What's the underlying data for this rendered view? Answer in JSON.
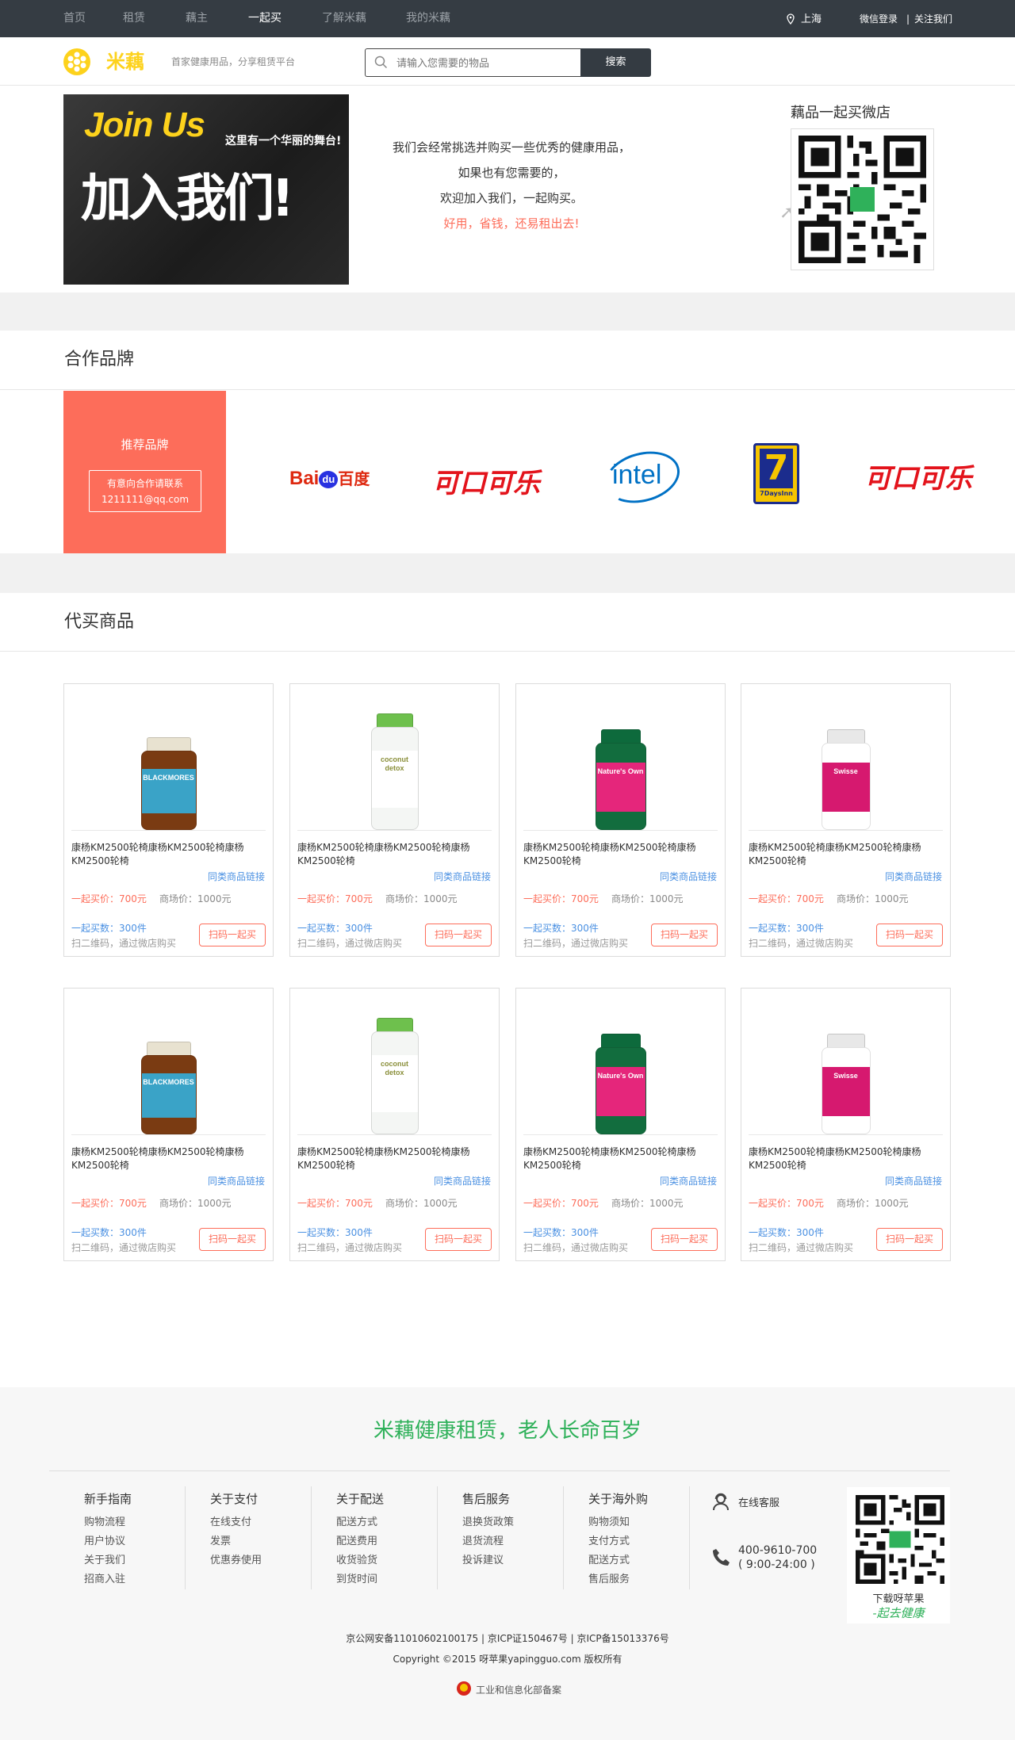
{
  "topnav": {
    "items": [
      "首页",
      "租赁",
      "藕主",
      "一起买",
      "了解米藕",
      "我的米藕"
    ],
    "active_index": 3,
    "location": "上海",
    "login": "微信登录",
    "separator": "|",
    "follow": "关注我们"
  },
  "header": {
    "logo_text": "米藕",
    "slogan": "首家健康用品，分享租赁平台",
    "search_placeholder": "请输入您需要的物品",
    "search_button": "搜索"
  },
  "hero": {
    "banner_join": "Join Us",
    "banner_sub": "这里有一个华丽的舞台!",
    "banner_big": "加入我们!",
    "lines": [
      "我们会经常挑选并购买一些优秀的健康用品，",
      "如果也有您需要的，",
      "欢迎加入我们，一起购买。"
    ],
    "highlight": "好用，省钱，还易租出去!",
    "qr_title": "藕品一起买微店"
  },
  "brands": {
    "title": "合作品牌",
    "recommend": "推荐品牌",
    "contact_label": "有意向合作请联系",
    "contact_email": "1211111@qq.com",
    "logos": [
      "Baidu百度",
      "可口可乐",
      "intel",
      "7 Days Inn",
      "可口可乐"
    ]
  },
  "products": {
    "title": "代买商品",
    "items": [
      {
        "title": "康杨KM2500轮椅康杨KM2500轮椅康杨KM2500轮椅",
        "link": "同类商品链接",
        "price": "一起买价：700元",
        "market": "商场价：1000元",
        "sold": "一起买数：300件",
        "scan": "扫二维码，通过微店购买",
        "button": "扫码一起买",
        "brand": "BLACKMORES"
      },
      {
        "title": "康杨KM2500轮椅康杨KM2500轮椅康杨KM2500轮椅",
        "link": "同类商品链接",
        "price": "一起买价：700元",
        "market": "商场价：1000元",
        "sold": "一起买数：300件",
        "scan": "扫二维码，通过微店购买",
        "button": "扫码一起买",
        "brand": "coconut detox"
      },
      {
        "title": "康杨KM2500轮椅康杨KM2500轮椅康杨KM2500轮椅",
        "link": "同类商品链接",
        "price": "一起买价：700元",
        "market": "商场价：1000元",
        "sold": "一起买数：300件",
        "scan": "扫二维码，通过微店购买",
        "button": "扫码一起买",
        "brand": "Nature's Own"
      },
      {
        "title": "康杨KM2500轮椅康杨KM2500轮椅康杨KM2500轮椅",
        "link": "同类商品链接",
        "price": "一起买价：700元",
        "market": "商场价：1000元",
        "sold": "一起买数：300件",
        "scan": "扫二维码，通过微店购买",
        "button": "扫码一起买",
        "brand": "Swisse"
      },
      {
        "title": "康杨KM2500轮椅康杨KM2500轮椅康杨KM2500轮椅",
        "link": "同类商品链接",
        "price": "一起买价：700元",
        "market": "商场价：1000元",
        "sold": "一起买数：300件",
        "scan": "扫二维码，通过微店购买",
        "button": "扫码一起买",
        "brand": "BLACKMORES"
      },
      {
        "title": "康杨KM2500轮椅康杨KM2500轮椅康杨KM2500轮椅",
        "link": "同类商品链接",
        "price": "一起买价：700元",
        "market": "商场价：1000元",
        "sold": "一起买数：300件",
        "scan": "扫二维码，通过微店购买",
        "button": "扫码一起买",
        "brand": "coconut detox"
      },
      {
        "title": "康杨KM2500轮椅康杨KM2500轮椅康杨KM2500轮椅",
        "link": "同类商品链接",
        "price": "一起买价：700元",
        "market": "商场价：1000元",
        "sold": "一起买数：300件",
        "scan": "扫二维码，通过微店购买",
        "button": "扫码一起买",
        "brand": "Nature's Own"
      },
      {
        "title": "康杨KM2500轮椅康杨KM2500轮椅康杨KM2500轮椅",
        "link": "同类商品链接",
        "price": "一起买价：700元",
        "market": "商场价：1000元",
        "sold": "一起买数：300件",
        "scan": "扫二维码，通过微店购买",
        "button": "扫码一起买",
        "brand": "Swisse"
      }
    ]
  },
  "footer": {
    "slogan": "米藕健康租赁，老人长命百岁",
    "columns": [
      {
        "title": "新手指南",
        "links": [
          "购物流程",
          "用户协议",
          "关于我们",
          "招商入驻"
        ]
      },
      {
        "title": "关于支付",
        "links": [
          "在线支付",
          "发票",
          "优惠券使用"
        ]
      },
      {
        "title": "关于配送",
        "links": [
          "配送方式",
          "配送费用",
          "收货验货",
          "到货时间"
        ]
      },
      {
        "title": "售后服务",
        "links": [
          "退换货政策",
          "退货流程",
          "投诉建议"
        ]
      },
      {
        "title": "关于海外购",
        "links": [
          "购物须知",
          "支付方式",
          "配送方式",
          "售后服务"
        ]
      }
    ],
    "service": "在线客服",
    "phone": "400-9610-700",
    "hours": "( 9:00-24:00 )",
    "qr_caption": "下载呀苹果",
    "qr_sign": "-起去健康",
    "icp": "京公网安备11010602100175 | 京ICP证150467号 | 京ICP备15013376号",
    "copyright": "Copyright ©2015 呀苹果yapingguo.com 版权所有",
    "miit": "工业和信息化部备案"
  },
  "colors": {
    "accent": "#fd6d5a",
    "link": "#4a90e2",
    "logo": "#fdd21c",
    "footer_green": "#2fb15a",
    "dark": "#353c43"
  }
}
